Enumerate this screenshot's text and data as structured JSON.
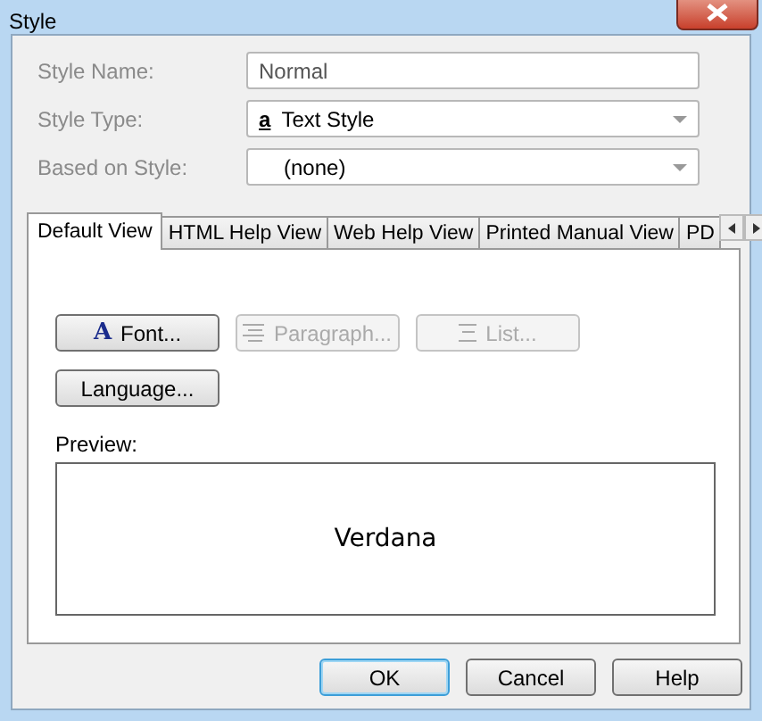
{
  "window": {
    "title": "Style"
  },
  "fields": [
    {
      "label": "Style Name:",
      "disabled": true,
      "kind": "text",
      "value": "Normal"
    },
    {
      "label": "Style Type:",
      "disabled": true,
      "kind": "dropdown",
      "glyph": "a",
      "value": "Text Style"
    },
    {
      "label": "Based on Style:",
      "disabled": true,
      "kind": "dropdown",
      "value": "(none)"
    }
  ],
  "tabs": [
    {
      "label": "Default View",
      "selected": true
    },
    {
      "label": "HTML Help View",
      "selected": false
    },
    {
      "label": "Web Help View",
      "selected": false
    },
    {
      "label": "Printed Manual View",
      "selected": false
    },
    {
      "label": "PD",
      "selected": false
    }
  ],
  "format_buttons": [
    {
      "label": "Font...",
      "kind": "font",
      "glyph": "A",
      "disabled": false
    },
    {
      "label": "Paragraph...",
      "kind": "paragraph",
      "disabled": true
    },
    {
      "label": "List...",
      "kind": "list",
      "disabled": true
    },
    {
      "label": "Language...",
      "kind": "plain",
      "disabled": false
    }
  ],
  "preview": {
    "label": "Preview:",
    "sample": "Verdana"
  },
  "buttons": [
    {
      "label": "OK",
      "default": true
    },
    {
      "label": "Cancel",
      "default": false
    },
    {
      "label": "Help",
      "default": false
    }
  ]
}
